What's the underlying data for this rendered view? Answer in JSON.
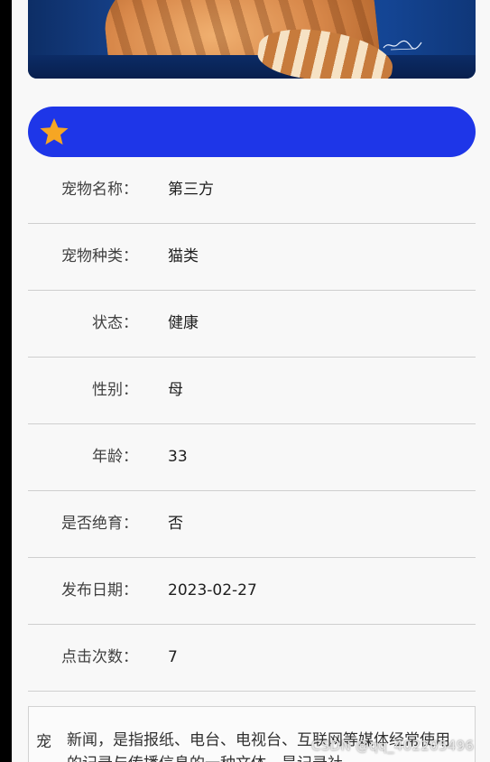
{
  "banner": {
    "icon": "star-icon",
    "colors": {
      "background": "#1e36e8",
      "star": "#f6a623"
    }
  },
  "details": [
    {
      "label": "宠物名称：",
      "value": "第三方"
    },
    {
      "label": "宠物种类：",
      "value": "猫类"
    },
    {
      "label": "状态：",
      "value": "健康"
    },
    {
      "label": "性别：",
      "value": "母"
    },
    {
      "label": "年龄：",
      "value": "33"
    },
    {
      "label": "是否绝育：",
      "value": "否"
    },
    {
      "label": "发布日期：",
      "value": "2023-02-27"
    },
    {
      "label": "点击次数：",
      "value": "7"
    }
  ],
  "description": {
    "label": "宠",
    "text": "新闻，是指报纸、电台、电视台、互联网等媒体经常使用的记录与传播信息的一种文体，是记录社"
  },
  "watermark": "CSDN @qq_402205496"
}
